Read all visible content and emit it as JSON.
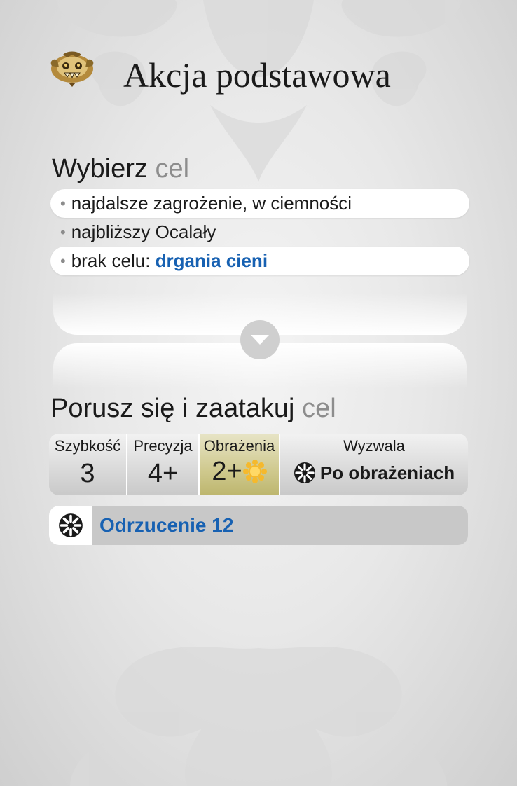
{
  "header": {
    "title": "Akcja podstawowa",
    "icon": "monster-icon"
  },
  "target_section": {
    "heading": "Wybierz",
    "heading_muted": "cel",
    "items": [
      {
        "bullet": "•",
        "text": "najdalsze zagrożenie, w ciemności",
        "highlight": "",
        "highlighted": true
      },
      {
        "bullet": "•",
        "text": "najbliższy Ocalały",
        "highlight": "",
        "highlighted": false
      },
      {
        "bullet": "•",
        "text": "brak celu: ",
        "highlight": "drgania cieni",
        "highlighted": true
      }
    ]
  },
  "action_section": {
    "heading": "Porusz się i zaatakuj",
    "heading_muted": "cel",
    "stats": [
      {
        "label": "Szybkość",
        "value": "3"
      },
      {
        "label": "Precyzja",
        "value": "4+"
      },
      {
        "label": "Obrażenia",
        "value": "2+"
      },
      {
        "label": "Wyzwala",
        "value": "Po obrażeniach"
      }
    ],
    "ability": {
      "text": "Odrzucenie 12",
      "icon": "impact-icon"
    }
  },
  "colors": {
    "blue": "#1761b2",
    "damage_gold": "#cfc98e",
    "sun": "#f5b92c"
  }
}
